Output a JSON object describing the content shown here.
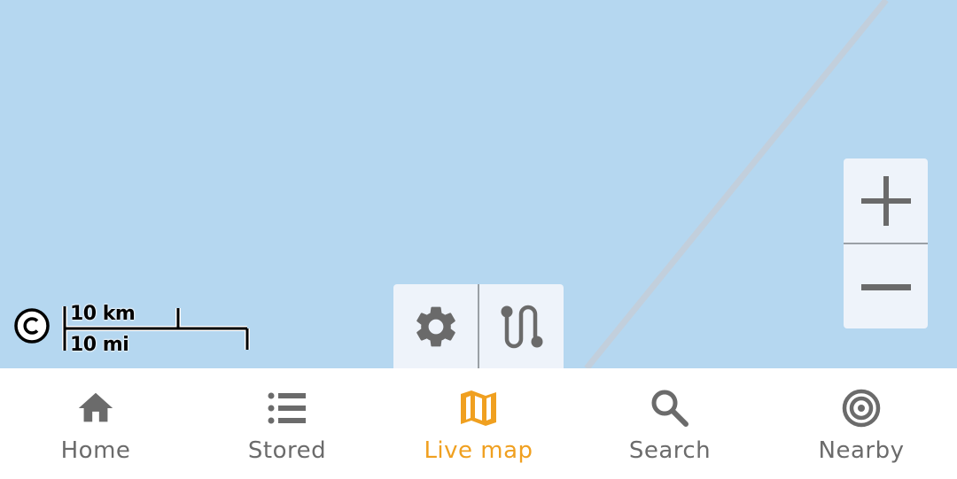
{
  "map": {
    "background_color": "#b5d7f0",
    "scale": {
      "metric_label": "10 km",
      "imperial_label": "10 mi"
    },
    "attribution_icon": "copyright-icon"
  },
  "map_tools": {
    "settings_icon": "gear-icon",
    "route_icon": "route-icon"
  },
  "zoom": {
    "in_icon": "plus-icon",
    "out_icon": "minus-icon"
  },
  "bottom_nav": {
    "active_color": "#f0a020",
    "inactive_color": "#6b6b6b",
    "items": [
      {
        "label": "Home",
        "icon": "home-icon",
        "active": false
      },
      {
        "label": "Stored",
        "icon": "list-icon",
        "active": false
      },
      {
        "label": "Live map",
        "icon": "map-icon",
        "active": true
      },
      {
        "label": "Search",
        "icon": "search-icon",
        "active": false
      },
      {
        "label": "Nearby",
        "icon": "nearby-icon",
        "active": false
      }
    ]
  }
}
